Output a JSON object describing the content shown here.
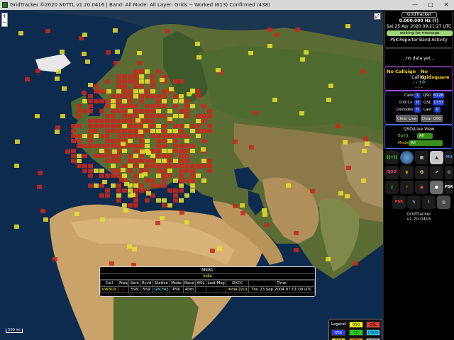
{
  "window": {
    "title": "GridTracker ©2020 N0TTL v1.20.0416 | Band: All Mode: All Layer: Grids -- Worked (613) Confirmed (438)"
  },
  "map": {
    "zoom_in": "+",
    "zoom_out": "−",
    "scale_label": "500 mi"
  },
  "popup": {
    "grid": "MK81",
    "country": "India",
    "columns": [
      "Call",
      "Freq",
      "Sent",
      "Rcvd",
      "Station",
      "Mode",
      "Band",
      "QSL",
      "Last Msg",
      "DXCC",
      "Time"
    ],
    "row": {
      "call": "VW3QX",
      "freq": "-",
      "sent": "599",
      "rcvd": "559",
      "station": "G8CNQ",
      "mode": "PSK",
      "band": "40m",
      "qsl": "",
      "last_msg": "-",
      "dxcc": "India (VU)",
      "time": "Thu 23 Sep 2004 07:01:00 UTC"
    }
  },
  "legend": {
    "title": "Legend",
    "items": [
      {
        "label": "QSO",
        "color": "#ffff00"
      },
      {
        "label": "QSL",
        "color": "#e03a2a"
      },
      {
        "label": "QSX",
        "color": "#2a3fff"
      },
      {
        "label": "CQ",
        "color": "#1fd11f"
      },
      {
        "label": "CQDX",
        "color": "#19c8ff"
      },
      {
        "label": "QRZ",
        "color": "#ffd11f"
      },
      {
        "label": "QTH",
        "color": "#ff8a00"
      },
      {
        "label": "WSPR",
        "color": "#cccccc"
      }
    ]
  },
  "panel": {
    "app_name": "GridTracker",
    "freq": "0.000.000 Hz (?)",
    "datetime": "Sat 25 Apr 2020 09:21:27 UTC",
    "status": "waiting for message",
    "psk_title": "PSK-Reporter Band Activity",
    "psk_empty": "..no data yet...",
    "no_callsign": "No Callsign",
    "no_gridsquare": "No Gridsquare",
    "calling": "Calling",
    "calling_val1": "- - +0",
    "calling_val2": "- - -",
    "calls_label": "Calls",
    "calls_val": "1",
    "qso_label": "QSO",
    "qso_val": "6126",
    "dxccs_label": "DXCCs",
    "dxccs_val": "0",
    "qsl_label": "QSL",
    "qsl_val": "1737",
    "decodes_label": "Decodes",
    "decodes_val": "0",
    "last_label": "Last",
    "last_val": "0",
    "clear_live": "Clear Live",
    "clear_qso": "Clear QSO",
    "view_title": "QSO/Live View",
    "band_label": "Band",
    "band_val": "All",
    "mode_label": "Mode",
    "mode_val": "All",
    "footer_name": "GridTracker",
    "footer_version": "v1.20.0416"
  },
  "colors": {
    "qso": "#e8e02a",
    "qsl": "#c8281e",
    "accent_blue": "#1d3fd0",
    "accent_green": "#3a8f1a"
  }
}
